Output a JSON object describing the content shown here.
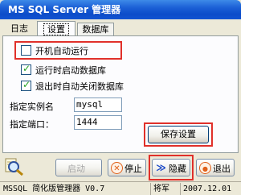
{
  "window": {
    "title": "MS SQL Server  管理器"
  },
  "tabs": [
    {
      "label": "日志"
    },
    {
      "label": "设置",
      "active": true
    },
    {
      "label": "数据库"
    }
  ],
  "settings": {
    "autostart_label": "开机自动运行",
    "autostart_checked": false,
    "start_db_label": "运行时启动数据库",
    "start_db_checked": true,
    "close_db_label": "退出时自动关闭数据库",
    "close_db_checked": true,
    "instance_label": "指定实例名",
    "instance_value": "mysql",
    "port_label": "指定端口：",
    "port_value": "1444",
    "save_label": "保存设置"
  },
  "toolbar": {
    "start_label": "启动",
    "stop_label": "停止",
    "hide_label": "隐藏",
    "exit_label": "退出"
  },
  "status": {
    "app_name": "MSSQL 简化版管理器 V0.7",
    "author": "将军",
    "date": "2007.12.01"
  },
  "colors": {
    "highlight": "#e0302a",
    "titlebar": "#1b5fd6",
    "check": "#21a121"
  }
}
